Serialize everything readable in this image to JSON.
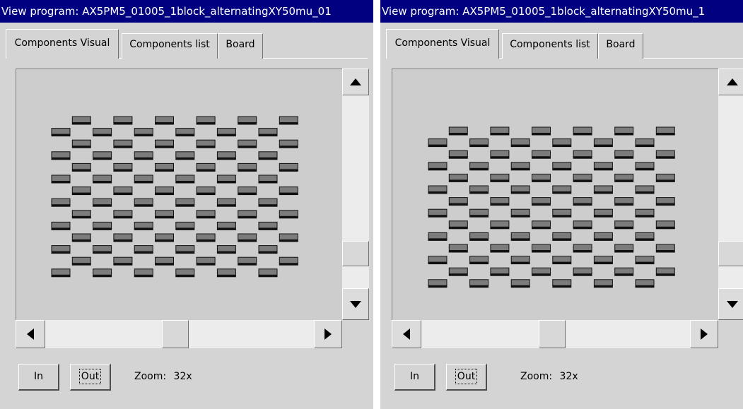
{
  "windows": [
    {
      "title": "View program: AX5PM5_01005_1block_alternatingXY50mu_01",
      "tabs": [
        "Components Visual",
        "Components list",
        "Board"
      ],
      "active_tab": "Components Visual",
      "zoom_label": "Zoom:",
      "zoom_value": "32x",
      "buttons": {
        "in": "In",
        "out": "Out"
      }
    },
    {
      "title": "View program: AX5PM5_01005_1block_alternatingXY50mu_1",
      "tabs": [
        "Components Visual",
        "Components list",
        "Board"
      ],
      "active_tab": "Components Visual",
      "zoom_label": "Zoom:",
      "zoom_value": "32x",
      "buttons": {
        "in": "In",
        "out": "Out"
      }
    }
  ],
  "board_pattern": {
    "rows": 14,
    "columns": 12,
    "component": "01005",
    "arrangement": "alternating"
  },
  "icons": [
    "arrow-up-icon",
    "arrow-down-icon",
    "arrow-left-icon",
    "arrow-right-icon",
    "component-pad-icon"
  ],
  "colors": {
    "title_bar": "#000080",
    "window_bg": "#d4d4d4",
    "viewport_bg": "#cdcdcd",
    "component_fill": "#7c7c7c",
    "component_edge": "#111111"
  }
}
